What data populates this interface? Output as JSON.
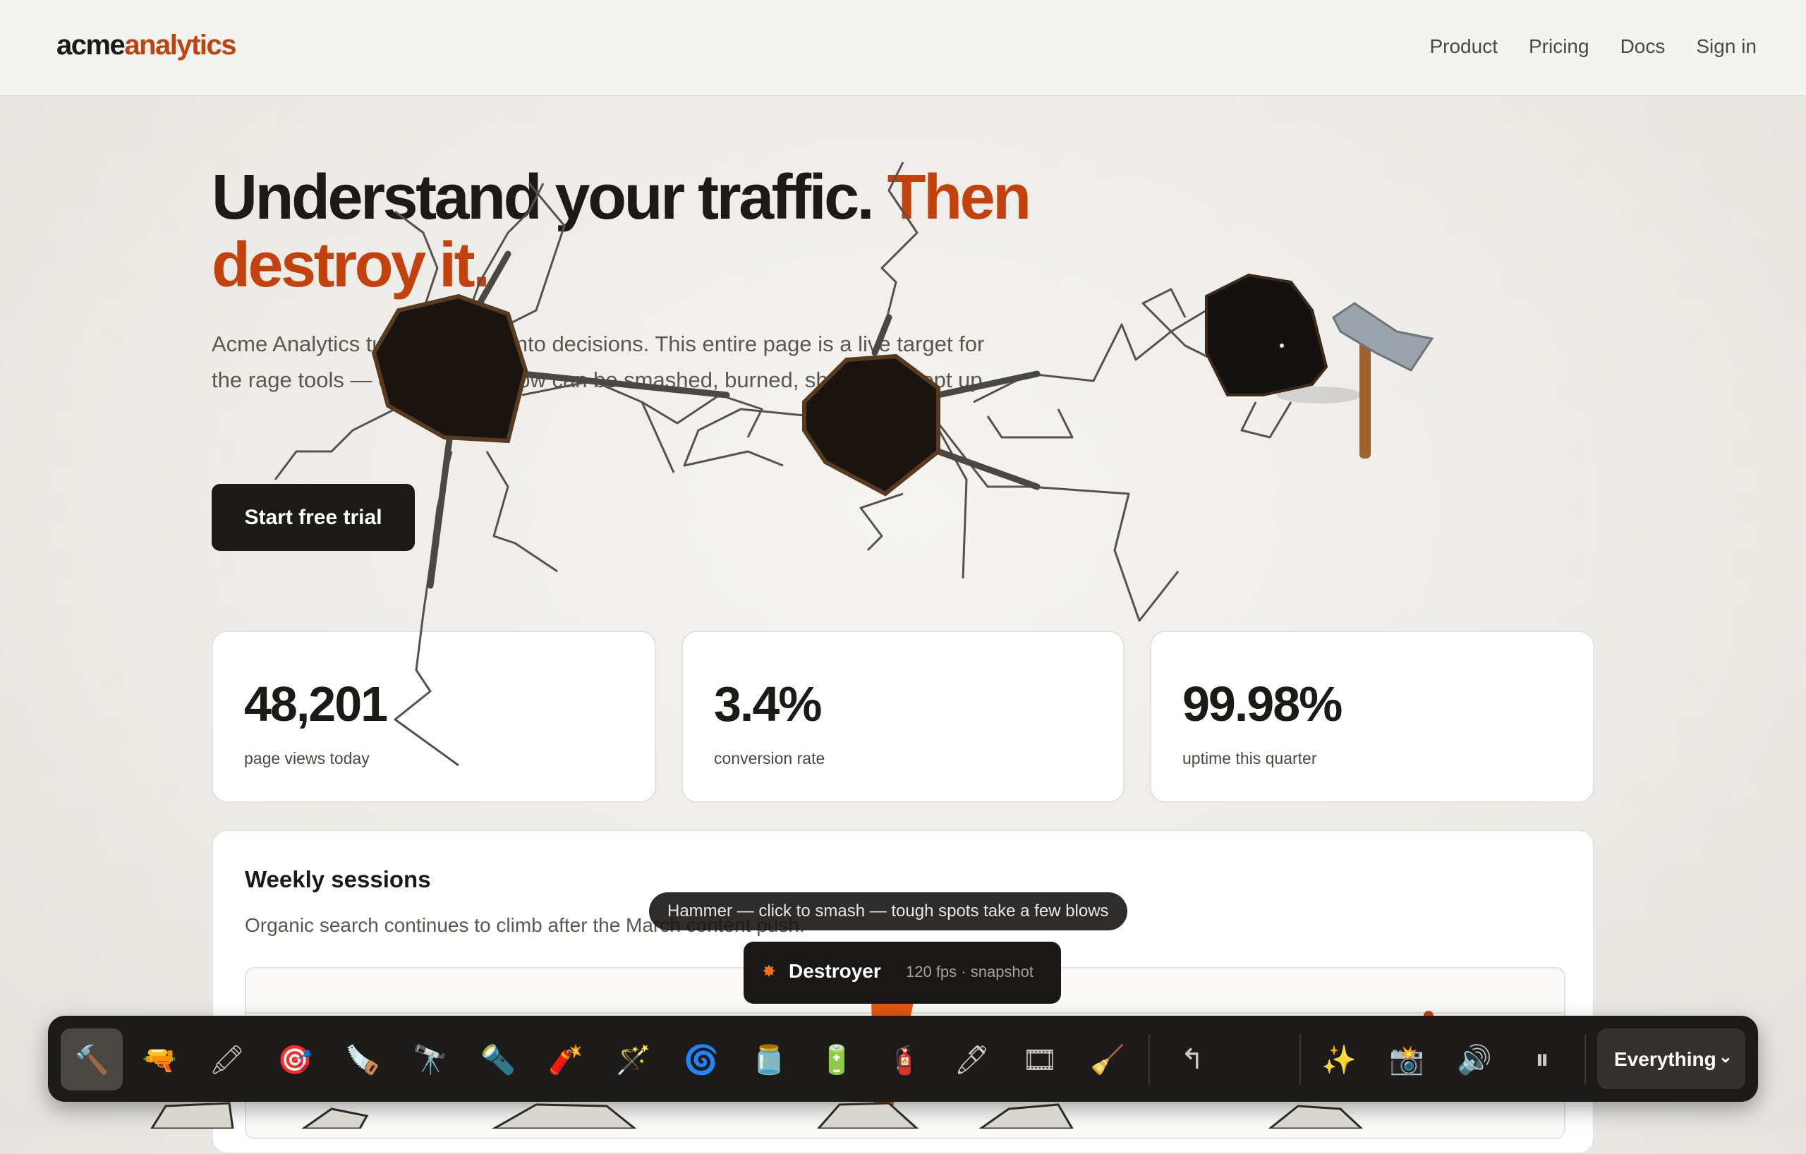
{
  "nav": {
    "logo_part1": "acme",
    "logo_part2": "analytics",
    "links": [
      "Product",
      "Pricing",
      "Docs",
      "Sign in"
    ]
  },
  "hero": {
    "title_main": "Understand your traffic. ",
    "title_accent": "Then destroy it.",
    "subtitle": "Acme Analytics turns requests into decisions. This entire page is a live target for the rage tools — every pixel below can be smashed, burned, shot and swept up.",
    "cta": "Start free trial"
  },
  "stats": [
    {
      "value": "48,201",
      "label": "page views today"
    },
    {
      "value": "3.4%",
      "label": "conversion rate"
    },
    {
      "value": "99.98%",
      "label": "uptime this quarter"
    }
  ],
  "weekly": {
    "title": "Weekly sessions",
    "description": "Organic search continues to climb after the March content push."
  },
  "tooltip": "Hammer — click to smash — tough spots take a few blows",
  "destroyer": {
    "icon": "explosion-icon",
    "name": "Destroyer",
    "meta": "120 fps · snapshot"
  },
  "toolbar": {
    "tools": [
      {
        "name": "hammer",
        "glyph": "🔨",
        "active": true
      },
      {
        "name": "gun",
        "glyph": "🔫"
      },
      {
        "name": "marker",
        "glyph": "🖍"
      },
      {
        "name": "dart",
        "glyph": "🎯"
      },
      {
        "name": "chainsaw",
        "glyph": "🪚"
      },
      {
        "name": "ray-gun",
        "glyph": "🔭"
      },
      {
        "name": "laser",
        "glyph": "🔦"
      },
      {
        "name": "bazooka",
        "glyph": "🧨"
      },
      {
        "name": "wand",
        "glyph": "🪄"
      },
      {
        "name": "vortex",
        "glyph": "🌀"
      },
      {
        "name": "jar",
        "glyph": "🫙"
      },
      {
        "name": "blaster",
        "glyph": "🔋"
      },
      {
        "name": "stick",
        "glyph": "🧯"
      },
      {
        "name": "pen",
        "glyph": "🖊"
      },
      {
        "name": "film",
        "glyph": "🎞"
      },
      {
        "name": "broom",
        "glyph": "🧹"
      }
    ],
    "undo_glyph": "↰",
    "extras": [
      {
        "name": "sparkles",
        "glyph": "✨"
      },
      {
        "name": "camera",
        "glyph": "📸"
      },
      {
        "name": "speaker",
        "glyph": "🔊"
      },
      {
        "name": "pause",
        "glyph": "⏸"
      }
    ],
    "select_value": "Everything"
  },
  "colors": {
    "accent": "#c2410c",
    "dark": "#1c1a17",
    "toolbar": "#1d1b19"
  }
}
